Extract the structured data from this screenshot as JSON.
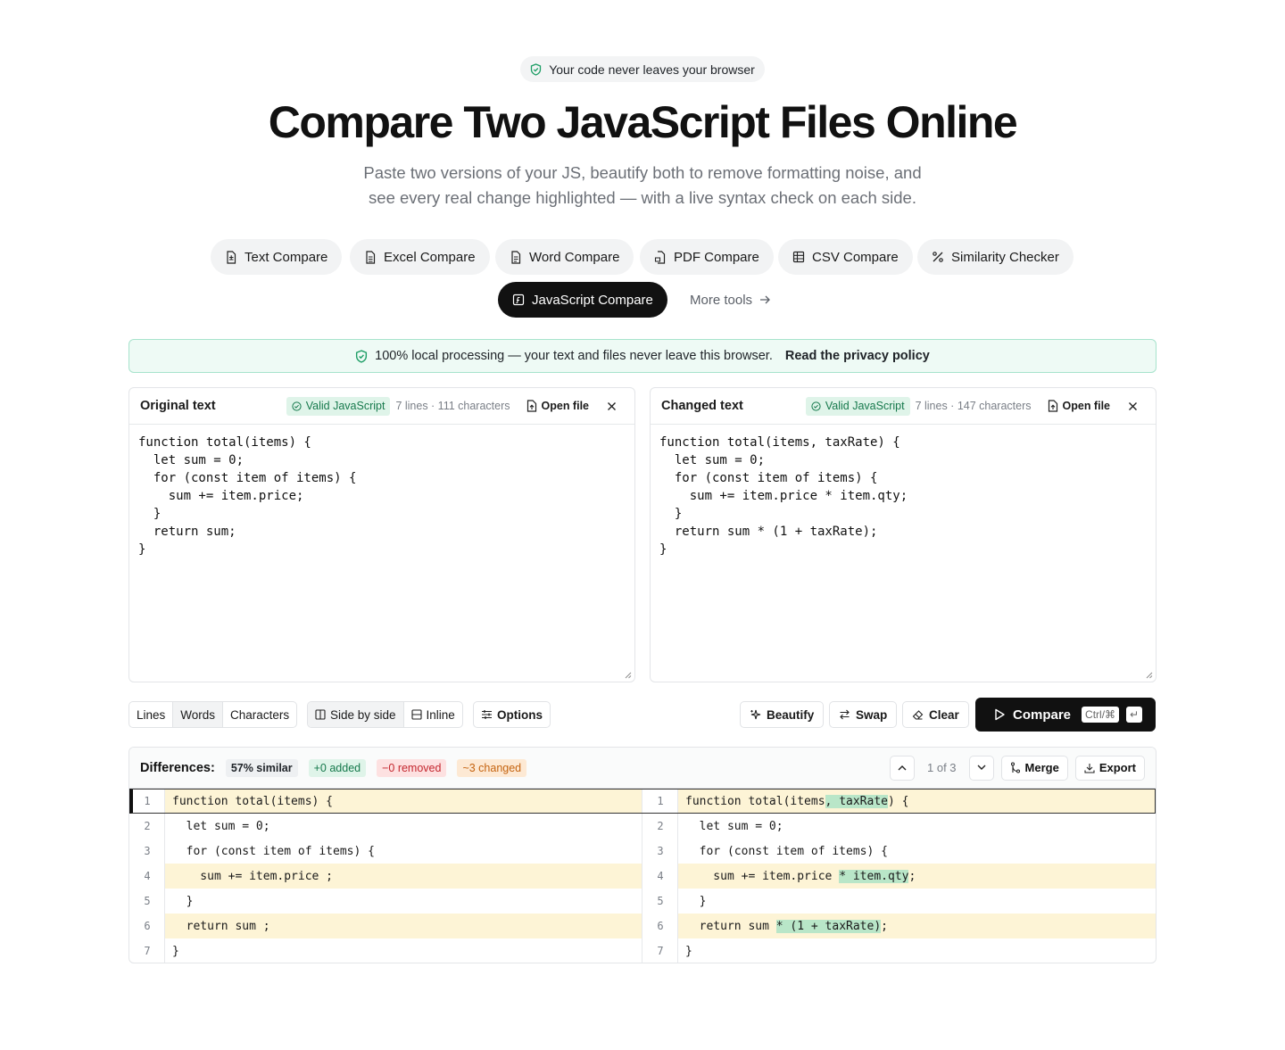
{
  "badge": {
    "icon": "shield-check-icon",
    "text": "Your code never leaves your browser"
  },
  "hero": {
    "title": "Compare Two JavaScript Files Online",
    "subtitle_line1": "Paste two versions of your JS, beautify both to remove formatting noise, and",
    "subtitle_line2": "see every real change highlighted — with a live syntax check on each side."
  },
  "tools": [
    {
      "label": "Text Compare",
      "icon": "file-text-icon"
    },
    {
      "label": "Excel Compare",
      "icon": "file-spreadsheet-icon"
    },
    {
      "label": "Word Compare",
      "icon": "file-lines-icon"
    },
    {
      "label": "PDF Compare",
      "icon": "file-pdf-icon"
    },
    {
      "label": "CSV Compare",
      "icon": "table-icon"
    },
    {
      "label": "Similarity Checker",
      "icon": "percent-icon"
    },
    {
      "label": "JavaScript Compare",
      "icon": "file-code-icon",
      "active": true
    }
  ],
  "more_tools": "More tools",
  "privacy": {
    "text": "100% local processing — your text and files never leave this browser.",
    "link": "Read the privacy policy"
  },
  "editors": {
    "left": {
      "title": "Original text",
      "status": "Valid JavaScript",
      "meta": "7 lines · 111 characters",
      "open_file": "Open file",
      "content": "function total(items) {\n  let sum = 0;\n  for (const item of items) {\n    sum += item.price;\n  }\n  return sum;\n}"
    },
    "right": {
      "title": "Changed text",
      "status": "Valid JavaScript",
      "meta": "7 lines · 147 characters",
      "open_file": "Open file",
      "content": "function total(items, taxRate) {\n  let sum = 0;\n  for (const item of items) {\n    sum += item.price * item.qty;\n  }\n  return sum * (1 + taxRate);\n}"
    }
  },
  "toolbar": {
    "granularity": [
      "Lines",
      "Words",
      "Characters"
    ],
    "granularity_selected": "Words",
    "views": [
      "Side by side",
      "Inline"
    ],
    "view_selected": "Side by side",
    "options": "Options",
    "beautify": "Beautify",
    "swap": "Swap",
    "clear": "Clear",
    "compare": "Compare",
    "shortcut": "Ctrl/⌘",
    "shortcut_enter": "↵"
  },
  "diff": {
    "label": "Differences:",
    "similar": "57% similar",
    "added": "+0 added",
    "removed": "−0 removed",
    "changed": "~3 changed",
    "position": "1 of 3",
    "merge": "Merge",
    "export": "Export",
    "rows": [
      {
        "n": "1",
        "changed": true,
        "left": [
          {
            "t": "function total(items) {"
          }
        ],
        "right": [
          {
            "t": "function total(items"
          },
          {
            "t": ", taxRate",
            "hl": true
          },
          {
            "t": ") {"
          }
        ]
      },
      {
        "n": "2",
        "changed": false,
        "left": [
          {
            "t": "  let sum = 0;"
          }
        ],
        "right": [
          {
            "t": "  let sum = 0;"
          }
        ]
      },
      {
        "n": "3",
        "changed": false,
        "left": [
          {
            "t": "  for (const item of items) {"
          }
        ],
        "right": [
          {
            "t": "  for (const item of items) {"
          }
        ]
      },
      {
        "n": "4",
        "changed": true,
        "left": [
          {
            "t": "    sum += item.price ;"
          }
        ],
        "right": [
          {
            "t": "    sum += item.price "
          },
          {
            "t": "* item.qty",
            "hl": true
          },
          {
            "t": ";"
          }
        ]
      },
      {
        "n": "5",
        "changed": false,
        "left": [
          {
            "t": "  }"
          }
        ],
        "right": [
          {
            "t": "  }"
          }
        ]
      },
      {
        "n": "6",
        "changed": true,
        "left": [
          {
            "t": "  return sum ;"
          }
        ],
        "right": [
          {
            "t": "  return sum "
          },
          {
            "t": "* (1 + taxRate)",
            "hl": true
          },
          {
            "t": ";"
          }
        ]
      },
      {
        "n": "7",
        "changed": false,
        "left": [
          {
            "t": "}"
          }
        ],
        "right": [
          {
            "t": "}"
          }
        ]
      }
    ]
  },
  "colors": {
    "accent": "#111111",
    "valid_bg": "#dff4e9",
    "changed_line": "#fdf4d6",
    "changed_word": "#b9e6c8"
  }
}
